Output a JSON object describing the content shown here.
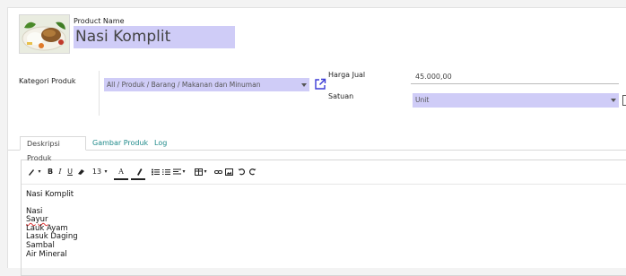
{
  "product": {
    "name_label": "Product Name",
    "name_value": "Nasi Komplit"
  },
  "fields": {
    "category_label": "Kategori Produk",
    "category_value": "All / Produk / Barang / Makanan dan Minuman",
    "price_label": "Harga Jual",
    "price_value": "45.000,00",
    "unit_label": "Satuan",
    "unit_value": "Unit"
  },
  "tabs": [
    {
      "label": "Deskripsi Produk",
      "active": true
    },
    {
      "label": "Gambar Produk",
      "active": false
    },
    {
      "label": "Log",
      "active": false
    }
  ],
  "toolbar": {
    "font_size": "13"
  },
  "description": {
    "title": "Nasi Komplit",
    "items": [
      "Nasi",
      "Sayur",
      "Lauk Ayam",
      "Lasuk Daging",
      "Sambal",
      "Air Mineral"
    ]
  },
  "colors": {
    "field_bg": "#cfccf7",
    "link": "#1f8a8a",
    "external_link_icon": "#3b3bd6"
  }
}
